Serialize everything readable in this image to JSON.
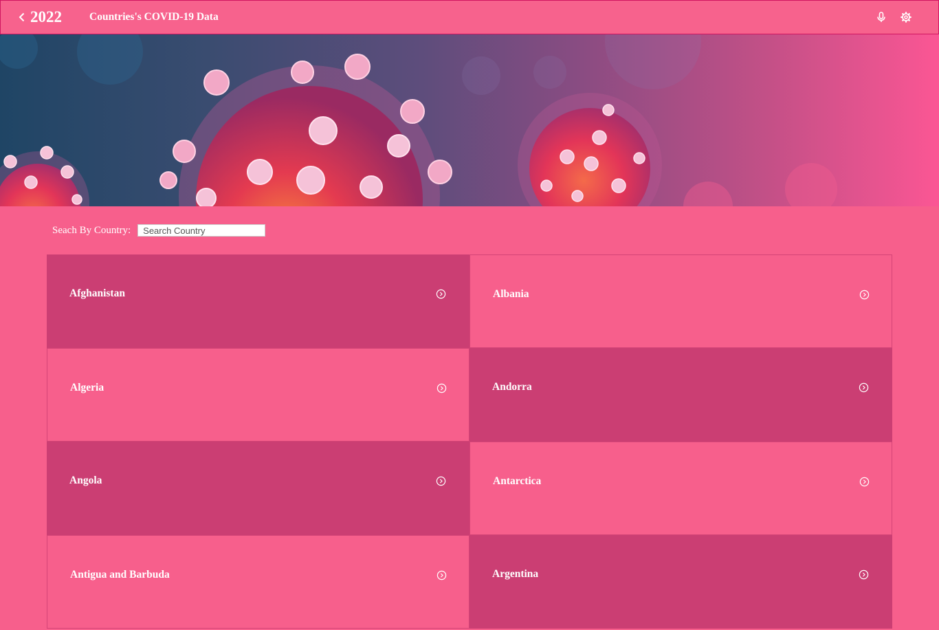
{
  "header": {
    "year": "2022",
    "title": "Countries's COVID-19 Data",
    "back_icon": "chevron-left-icon",
    "mic_icon": "microphone-icon",
    "settings_icon": "gear-icon"
  },
  "hero": {
    "image": "coronavirus-banner",
    "colors": {
      "left": "#1f4565",
      "right": "#fb5694"
    }
  },
  "search": {
    "label": "Seach By Country:",
    "placeholder": "Search Country",
    "value": ""
  },
  "countries": [
    {
      "name": "Afghanistan",
      "tone": "dark"
    },
    {
      "name": "Albania",
      "tone": "light"
    },
    {
      "name": "Algeria",
      "tone": "light"
    },
    {
      "name": "Andorra",
      "tone": "dark"
    },
    {
      "name": "Angola",
      "tone": "dark"
    },
    {
      "name": "Antarctica",
      "tone": "light"
    },
    {
      "name": "Antigua and Barbuda",
      "tone": "light"
    },
    {
      "name": "Argentina",
      "tone": "dark"
    }
  ],
  "colors": {
    "page_bg": "#f75f8c",
    "tile_dark": "#cb3e73",
    "tile_light": "#f75f8c",
    "text": "#ffffff"
  }
}
